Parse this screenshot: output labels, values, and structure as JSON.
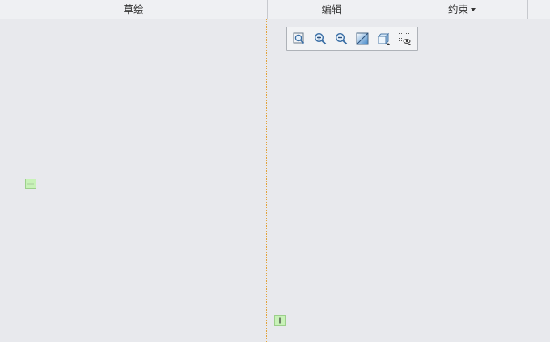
{
  "ribbon": {
    "tabs": [
      {
        "label": "草绘"
      },
      {
        "label": "编辑"
      },
      {
        "label": "约束"
      }
    ]
  },
  "view_toolbar": {
    "buttons": [
      {
        "icon": "zoom-fit-icon"
      },
      {
        "icon": "zoom-in-icon"
      },
      {
        "icon": "zoom-out-icon"
      },
      {
        "icon": "display-style-icon"
      },
      {
        "icon": "view-orientation-icon"
      },
      {
        "icon": "sketch-display-filter-icon"
      }
    ]
  },
  "canvas": {
    "axis_color": "#e2a23a",
    "constraint_tags": [
      {
        "type": "horizontal-constraint-icon"
      },
      {
        "type": "vertical-constraint-icon"
      }
    ]
  }
}
